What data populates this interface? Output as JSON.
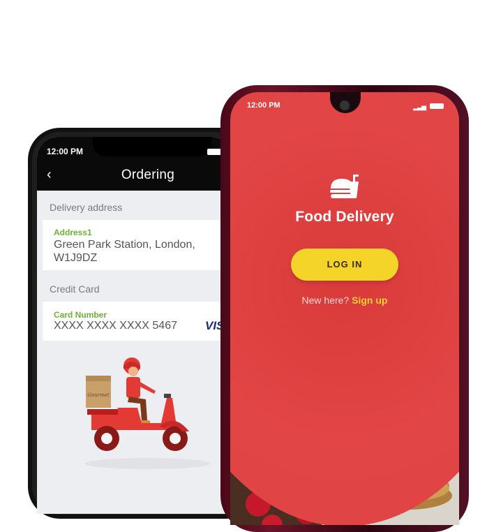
{
  "ordering_screen": {
    "status_time": "12:00 PM",
    "back_icon": "back-arrow-icon",
    "title": "Ordering",
    "delivery_section_label": "Delivery address",
    "address_label": "Address1",
    "address_value": "Green Park Station, London, W1J9DZ",
    "credit_section_label": "Credit Card",
    "card_label": "Card Number",
    "card_value": "XXXX XXXX XXXX 5467",
    "card_brand": "VISA",
    "illustration": "scooter-delivery-illustration",
    "colors": {
      "header": "#0a0a0a",
      "field_label": "#6ab335",
      "background": "#edeef2"
    }
  },
  "login_screen": {
    "status_time": "12:00 PM",
    "logo_icon": "burger-drink-icon",
    "app_title": "Food Delivery",
    "login_button": "LOG IN",
    "signup_prompt": "New here?",
    "signup_link": "Sign up",
    "food_image": "strawberries-pancakes-photo",
    "colors": {
      "primary": "#e04444",
      "button": "#f5d42a",
      "link": "#ffd23a"
    }
  }
}
